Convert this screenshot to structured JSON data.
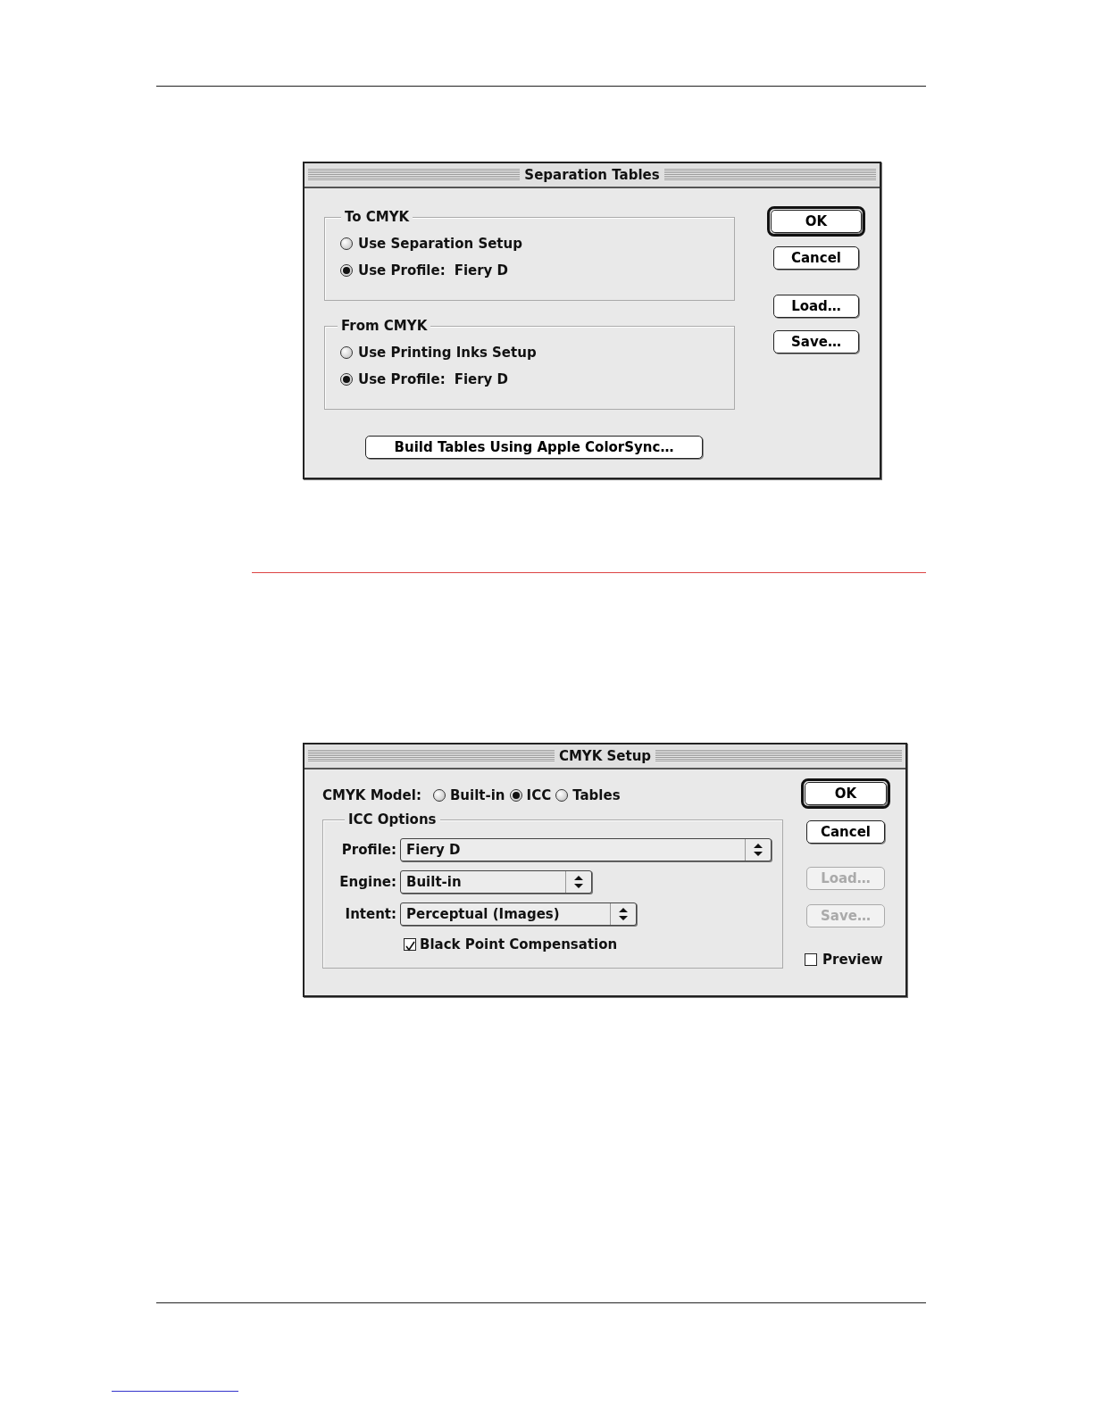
{
  "separation_tables": {
    "title": "Separation Tables",
    "groups": [
      {
        "label": "To CMYK",
        "options": [
          {
            "label": "Use Separation Setup",
            "selected": false
          },
          {
            "label": "Use Profile:",
            "value": "Fiery D",
            "selected": true
          }
        ]
      },
      {
        "label": "From CMYK",
        "options": [
          {
            "label": "Use Printing Inks Setup",
            "selected": false
          },
          {
            "label": "Use Profile:",
            "value": "Fiery D",
            "selected": true
          }
        ]
      }
    ],
    "build_button": "Build Tables Using Apple ColorSync…",
    "buttons": [
      {
        "label": "OK",
        "default": true,
        "disabled": false
      },
      {
        "label": "Cancel",
        "default": false,
        "disabled": false
      },
      {
        "label": "Load…",
        "default": false,
        "disabled": false
      },
      {
        "label": "Save…",
        "default": false,
        "disabled": false
      }
    ]
  },
  "cmyk_setup": {
    "title": "CMYK Setup",
    "model_label": "CMYK Model:",
    "models": [
      {
        "label": "Built-in",
        "selected": false
      },
      {
        "label": "ICC",
        "selected": true
      },
      {
        "label": "Tables",
        "selected": false
      }
    ],
    "group_label": "ICC Options",
    "popups": [
      {
        "label": "Profile:",
        "value": "Fiery D"
      },
      {
        "label": "Engine:",
        "value": "Built-in"
      },
      {
        "label": "Intent:",
        "value": "Perceptual (Images)"
      }
    ],
    "black_point": {
      "label": "Black Point Compensation",
      "checked": true
    },
    "buttons": [
      {
        "label": "OK",
        "default": true,
        "disabled": false
      },
      {
        "label": "Cancel",
        "default": false,
        "disabled": false
      },
      {
        "label": "Load…",
        "default": false,
        "disabled": true
      },
      {
        "label": "Save…",
        "default": false,
        "disabled": true
      }
    ],
    "preview": {
      "label": "Preview",
      "checked": false
    }
  }
}
